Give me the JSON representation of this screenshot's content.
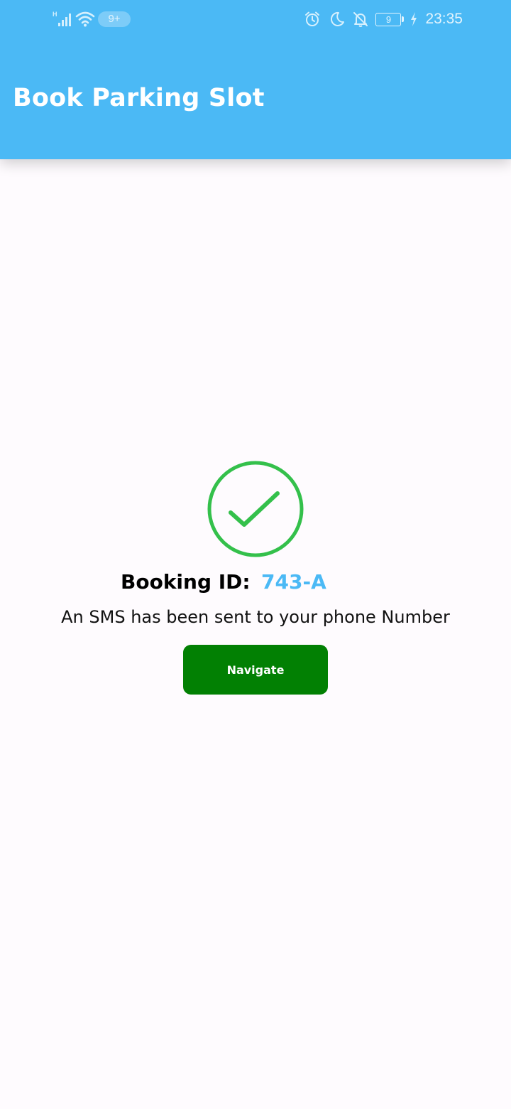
{
  "status_bar": {
    "network_type": "H",
    "notification_badge": "9+",
    "battery_level": "9",
    "time": "23:35",
    "icons": [
      "signal-icon",
      "wifi-icon",
      "alarm-icon",
      "moon-icon",
      "notifications-off-icon",
      "battery-icon",
      "charging-icon"
    ]
  },
  "app_bar": {
    "title": "Book Parking Slot",
    "color": "#4bb9f5"
  },
  "confirmation": {
    "icon": "check-circle-icon",
    "icon_color": "#34c04b",
    "booking_label": "Booking ID:",
    "booking_id": "743-A",
    "booking_id_color": "#4bb9f5",
    "message": "An SMS has been sent to your phone Number",
    "button_label": "Navigate",
    "button_color": "#028003"
  }
}
